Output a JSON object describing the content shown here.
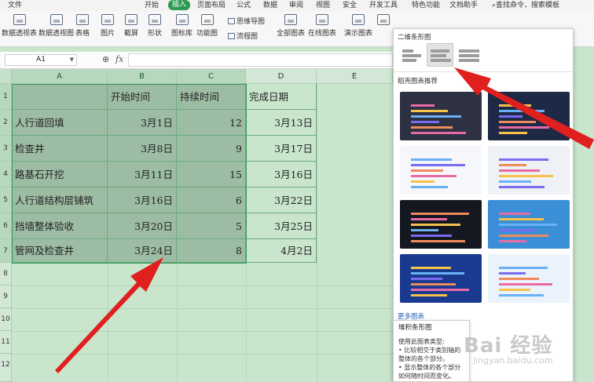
{
  "menubar": {
    "items": [
      "文件",
      "开始",
      "插入",
      "页面布局",
      "公式",
      "数据",
      "审阅",
      "视图",
      "安全",
      "开发工具",
      "特色功能",
      "文档助手"
    ],
    "search": "查找命令、搜索模板"
  },
  "ribbon": {
    "buttons": [
      "数据透视表",
      "数据透视图",
      "表格",
      "图片",
      "截屏",
      "形状",
      "图标库",
      "功能图",
      "全部图表",
      "在线图表",
      "演示图表"
    ],
    "small": [
      "思维导图",
      "流程图"
    ]
  },
  "formula": {
    "namebox": "A1",
    "fx": "fx",
    "value": ""
  },
  "columns": [
    "A",
    "B",
    "C",
    "D",
    "E"
  ],
  "rows": [
    "1",
    "2",
    "3",
    "4",
    "5",
    "6",
    "7",
    "8",
    "9",
    "10",
    "11",
    "12"
  ],
  "table": {
    "headers": [
      "",
      "开始时间",
      "持续时间",
      "完成日期"
    ],
    "rows": [
      [
        "人行道回填",
        "3月1日",
        "12",
        "3月13日"
      ],
      [
        "检查井",
        "3月8日",
        "9",
        "3月17日"
      ],
      [
        "路基石开挖",
        "3月11日",
        "15",
        "3月16日"
      ],
      [
        "人行道结构层铺筑",
        "3月16日",
        "6",
        "3月22日"
      ],
      [
        "挡墙整体验收",
        "3月20日",
        "5",
        "3月25日"
      ],
      [
        "管网及检查井",
        "3月24日",
        "8",
        "4月2日"
      ]
    ]
  },
  "panel": {
    "section_title": "二维条形图",
    "recommend_title": "稻壳图表推荐",
    "more_link": "更多图表",
    "thumb_colors": [
      "#2d3142",
      "#1e2a45",
      "#f5f7fb",
      "#eef2f6",
      "#141820",
      "#3a8fd6",
      "#1a3a8f",
      "#eaf3fb"
    ],
    "bar_colors": [
      "#e86aa4",
      "#f5c24b",
      "#6ab0f5",
      "#7a6cf0",
      "#f08a5d"
    ]
  },
  "tooltip": {
    "title": "堆积条形图",
    "line1": "使用此图表类型:",
    "line2": "• 比较相交于类别轴的",
    "line3": "整体的各个部分。",
    "line4": "• 显示整体的各个部分",
    "line5": "如何随时间而变化。"
  },
  "watermark": {
    "brand": "Bai 经验",
    "url": "jingyan.baidu.com"
  },
  "colors": {
    "accent": "#2e9b55",
    "arrow": "#e0201f",
    "sheet_bg": "#c9e6cc"
  }
}
